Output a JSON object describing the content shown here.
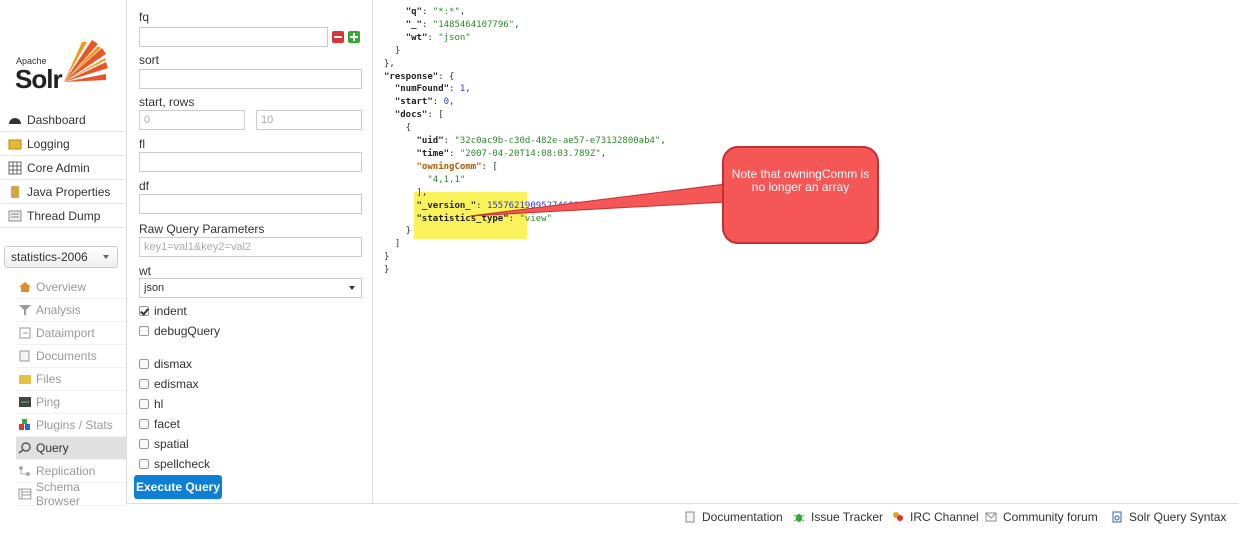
{
  "logo": {
    "apache": "Apache",
    "solr": "Solr"
  },
  "nav": [
    {
      "label": "Dashboard",
      "icon": "dashboard-icon"
    },
    {
      "label": "Logging",
      "icon": "logging-icon"
    },
    {
      "label": "Core Admin",
      "icon": "core-admin-icon"
    },
    {
      "label": "Java Properties",
      "icon": "java-properties-icon"
    },
    {
      "label": "Thread Dump",
      "icon": "thread-dump-icon"
    }
  ],
  "core_selector": {
    "value": "statistics-2006"
  },
  "core_menu": [
    {
      "label": "Overview"
    },
    {
      "label": "Analysis"
    },
    {
      "label": "Dataimport"
    },
    {
      "label": "Documents"
    },
    {
      "label": "Files"
    },
    {
      "label": "Ping"
    },
    {
      "label": "Plugins / Stats"
    },
    {
      "label": "Query"
    },
    {
      "label": "Replication"
    },
    {
      "label": "Schema Browser"
    }
  ],
  "form": {
    "fq_label": "fq",
    "sort_label": "sort",
    "start_rows_label": "start, rows",
    "start_value": "0",
    "rows_value": "10",
    "fl_label": "fl",
    "df_label": "df",
    "raw_label": "Raw Query Parameters",
    "raw_placeholder": "key1=val1&key2=val2",
    "wt_label": "wt",
    "wt_value": "json",
    "indent": "indent",
    "debugQuery": "debugQuery",
    "dismax": "dismax",
    "edismax": "edismax",
    "hl": "hl",
    "facet": "facet",
    "spatial": "spatial",
    "spellcheck": "spellcheck",
    "execute": "Execute Query"
  },
  "json": {
    "q_key": "\"q\"",
    "q_val": "\"*:*\"",
    "us_key": "\"_\"",
    "us_val": "\"1485464107796\"",
    "wt_key": "\"wt\"",
    "wt_val": "\"json\"",
    "response_key": "\"response\"",
    "numFound_key": "\"numFound\"",
    "numFound_val": "1",
    "start_key": "\"start\"",
    "start_val": "0",
    "docs_key": "\"docs\"",
    "uid_key": "\"uid\"",
    "uid_val": "\"32c0ac9b-c30d-482e-ae57-e73132800ab4\"",
    "time_key": "\"time\"",
    "time_val": "\"2007-04-20T14:08:03.789Z\"",
    "owning_key": "\"owningComm\"",
    "owning_val": "\"4,1,1\"",
    "version_key": "\"_version_\"",
    "version_val": "1557621909527462000",
    "stype_key": "\"statistics_type\"",
    "stype_val": "\"view\""
  },
  "callout": {
    "text": "Note that owningComm is no longer an array"
  },
  "footer": [
    {
      "label": "Documentation",
      "icon": "documentation-icon"
    },
    {
      "label": "Issue Tracker",
      "icon": "bug-icon"
    },
    {
      "label": "IRC Channel",
      "icon": "irc-icon"
    },
    {
      "label": "Community forum",
      "icon": "mail-icon"
    },
    {
      "label": "Solr Query Syntax",
      "icon": "syntax-icon"
    }
  ]
}
